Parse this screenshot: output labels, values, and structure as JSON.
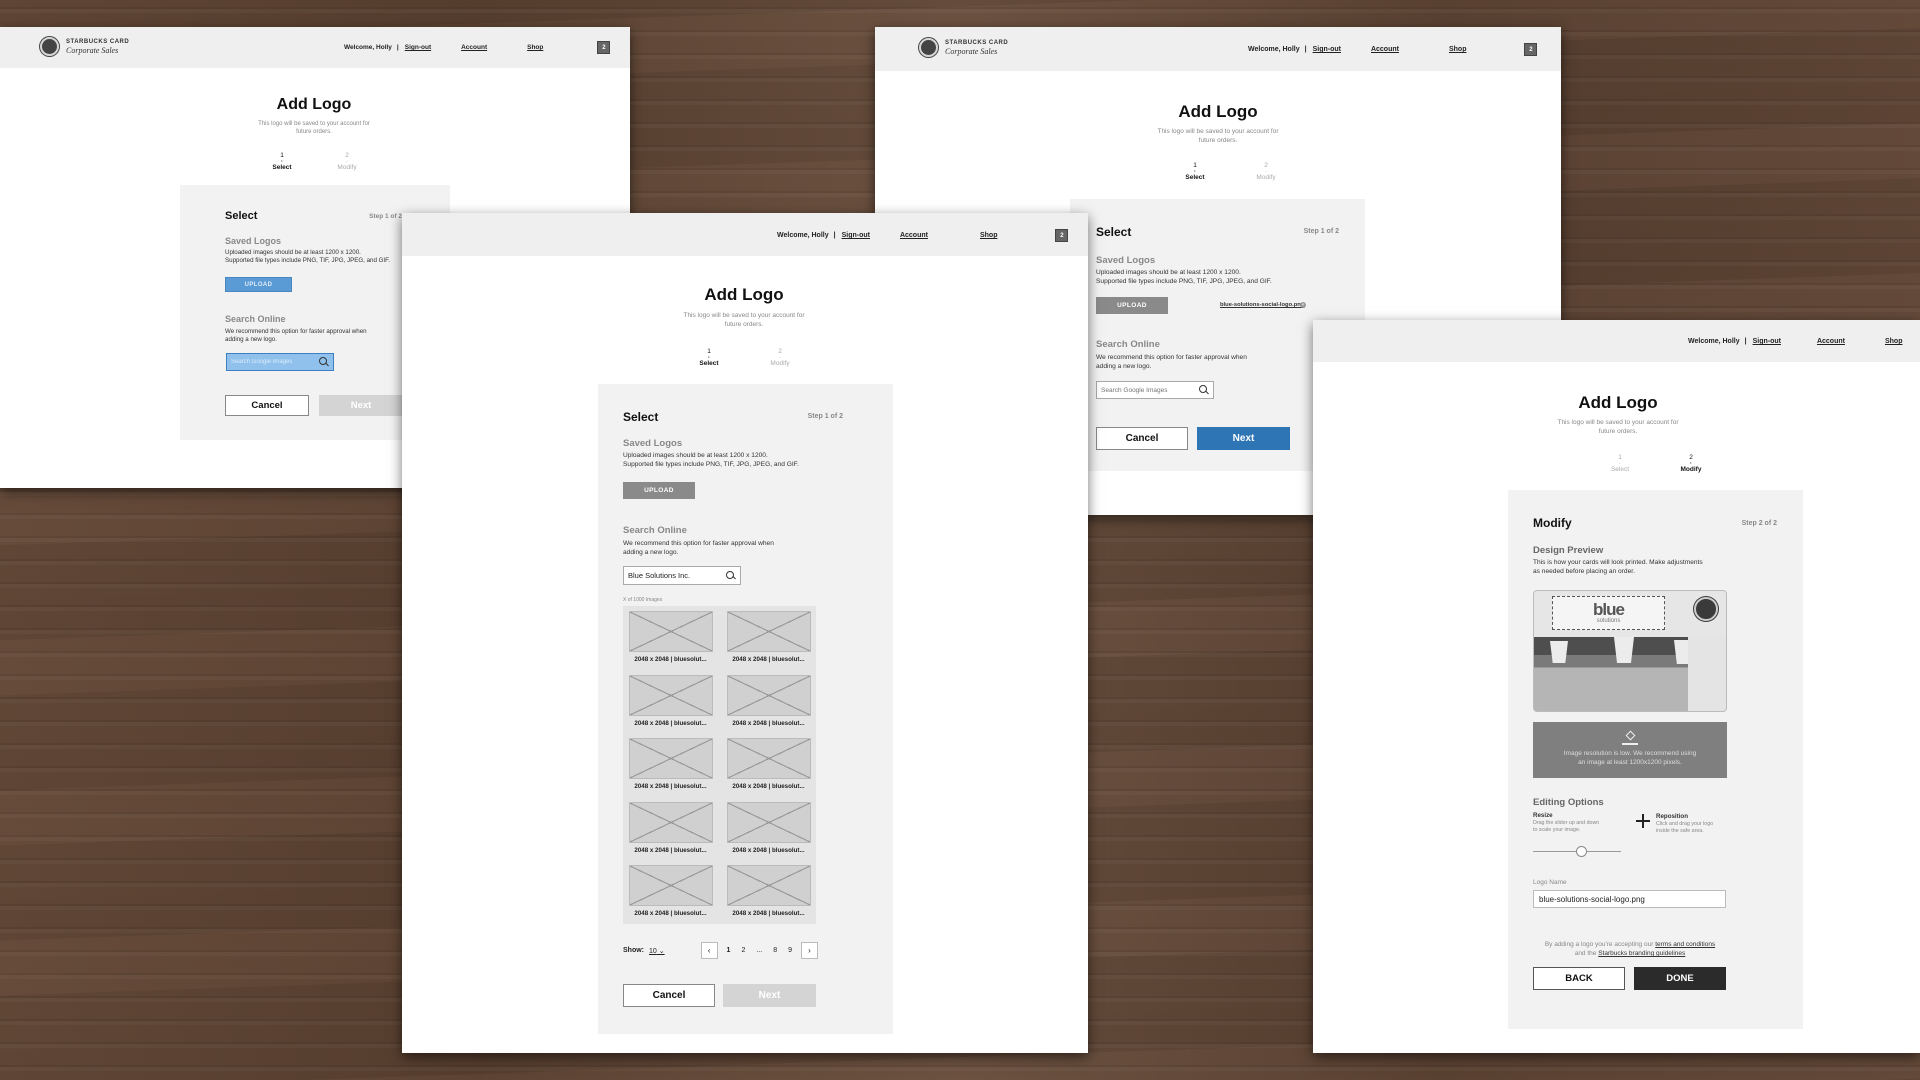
{
  "header": {
    "brand_line1": "STARBUCKS CARD",
    "brand_line2": "Corporate Sales",
    "welcome": "Welcome, Holly",
    "sign_out": "Sign-out",
    "account": "Account",
    "shop": "Shop",
    "cart_count": "2"
  },
  "page": {
    "title": "Add Logo",
    "subtitle_l1": "This logo will be saved to your account for",
    "subtitle_l2": "future orders."
  },
  "steps": [
    {
      "num": "1",
      "label": "Select"
    },
    {
      "num": "2",
      "label": "Modify"
    }
  ],
  "select": {
    "title": "Select",
    "step": "Step 1 of 2",
    "saved_heading": "Saved Logos",
    "saved_l1": "Uploaded images should be at least 1200 x 1200.",
    "saved_l2": "Supported file types include PNG, TIF, JPG, JPEG, and GIF.",
    "upload": "UPLOAD",
    "search_heading": "Search Online",
    "search_l1": "We recommend this option for faster approval when",
    "search_l2": "adding a new logo.",
    "search_placeholder": "Search Google Images",
    "cancel": "Cancel",
    "next": "Next"
  },
  "results": {
    "query": "Blue Solutions Inc.",
    "count": "X of 1000 Images",
    "tile_caption": "2048 x 2048 | bluesolut...",
    "show_label": "Show:",
    "show_value": "10",
    "pages": [
      "1",
      "2",
      "...",
      "8",
      "9"
    ],
    "prev": "‹",
    "next": "›"
  },
  "saved_file": "blue-solutions-social-logo.png",
  "modify": {
    "title": "Modify",
    "step": "Step 2 of 2",
    "preview_heading": "Design Preview",
    "preview_l1": "This is how your cards will look printed. Make adjustments",
    "preview_l2": "as needed before placing an order.",
    "logo_text": "blue",
    "logo_sub": "solutions",
    "warn_l1": "Image resolution is low. We recommend using",
    "warn_l2": "an image at least 1200x1200 pixels.",
    "editing_heading": "Editing Options",
    "resize_label": "Resize",
    "resize_l1": "Drag the slider up and down",
    "resize_l2": "to scale your image.",
    "resize_level": 0.55,
    "reposition_label": "Reposition",
    "reposition_l1": "Click and drag your logo",
    "reposition_l2": "inside the safe area.",
    "logo_name_label": "Logo Name",
    "logo_name_value": "blue-solutions-social-logo.png",
    "terms_pre": "By adding a logo you're accepting our",
    "terms_link": "terms and conditions",
    "terms_mid": "and the",
    "guidelines_link": "Starbucks branding guidelines",
    "back": "BACK",
    "done": "DONE"
  }
}
